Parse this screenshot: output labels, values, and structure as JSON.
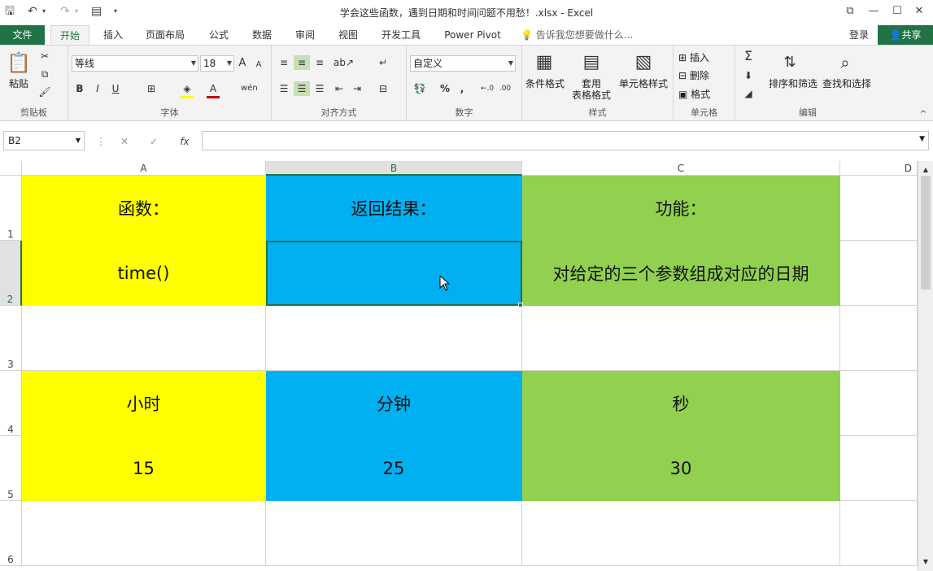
{
  "window": {
    "title": "学会这些函数，遇到日期和时间问题不用愁！.xlsx - Excel",
    "min_label": "—",
    "max_label": "☐",
    "close_label": "✕",
    "restore_label": "⧉"
  },
  "tabs": [
    {
      "label": "文件"
    },
    {
      "label": "开始"
    },
    {
      "label": "插入"
    },
    {
      "label": "页面布局"
    },
    {
      "label": "公式"
    },
    {
      "label": "数据"
    },
    {
      "label": "审阅"
    },
    {
      "label": "视图"
    },
    {
      "label": "开发工具"
    },
    {
      "label": "Power Pivot"
    }
  ],
  "tellme": "告诉我您想要做什么...",
  "login": "登录",
  "share": "共享",
  "ribbon": {
    "clipboard": {
      "paste": "粘贴",
      "label": "剪贴板"
    },
    "font": {
      "name": "等线",
      "size": "18",
      "label": "字体"
    },
    "align": {
      "label": "对齐方式"
    },
    "number": {
      "format": "自定义",
      "percent": "%",
      "comma": ",",
      "label": "数字"
    },
    "styles": {
      "cond": "条件格式",
      "table1": "套用",
      "table2": "表格格式",
      "cell": "单元格样式",
      "label": "样式"
    },
    "cells": {
      "insert": "插入",
      "delete": "删除",
      "format": "格式",
      "label": "单元格"
    },
    "edit": {
      "sort": "排序和筛选",
      "find": "查找和选择",
      "label": "编辑"
    }
  },
  "formula_bar": {
    "name_box": "B2",
    "fx": "fx",
    "cancel": "✕",
    "enter": "✓",
    "value": ""
  },
  "columns": [
    "A",
    "B",
    "C",
    "D"
  ],
  "rows": [
    "1",
    "2",
    "3",
    "4",
    "5",
    "6"
  ],
  "cells": {
    "a1": "函数：",
    "b1": "返回结果：",
    "c1": "功能：",
    "a2": "time()",
    "b2": "",
    "c2": "对给定的三个参数组成对应的日期",
    "a4": "小时",
    "b4": "分钟",
    "c4": "秒",
    "a5": "15",
    "b5": "25",
    "c5": "30"
  },
  "colors": {
    "yellow": "#ffff00",
    "blue": "#00b0f0",
    "green": "#92d050",
    "excel_green": "#217346"
  }
}
